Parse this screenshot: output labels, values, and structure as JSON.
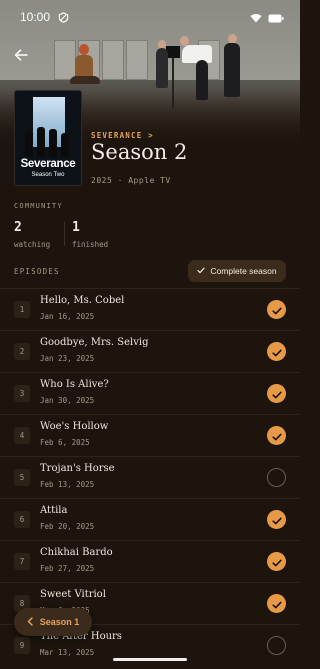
{
  "status_bar": {
    "time": "10:00"
  },
  "show": {
    "name": "SEVERANCE",
    "link_suffix": " >"
  },
  "poster": {
    "title": "Severance",
    "subtitle": "Season Two"
  },
  "season": {
    "title": "Season 2",
    "meta": "2025 · Apple TV"
  },
  "community": {
    "label": "COMMUNITY",
    "watching": {
      "count": "2",
      "label": "watching"
    },
    "finished": {
      "count": "1",
      "label": "finished"
    }
  },
  "episodes_section": {
    "label": "EPISODES",
    "complete_button": "Complete season"
  },
  "episodes": [
    {
      "number": "1",
      "title": "Hello, Ms. Cobel",
      "date": "Jan 16, 2025",
      "watched": true
    },
    {
      "number": "2",
      "title": "Goodbye, Mrs. Selvig",
      "date": "Jan 23, 2025",
      "watched": true
    },
    {
      "number": "3",
      "title": "Who Is Alive?",
      "date": "Jan 30, 2025",
      "watched": true
    },
    {
      "number": "4",
      "title": "Woe's Hollow",
      "date": "Feb 6, 2025",
      "watched": true
    },
    {
      "number": "5",
      "title": "Trojan's Horse",
      "date": "Feb 13, 2025",
      "watched": false
    },
    {
      "number": "6",
      "title": "Attila",
      "date": "Feb 20, 2025",
      "watched": true
    },
    {
      "number": "7",
      "title": "Chikhai Bardo",
      "date": "Feb 27, 2025",
      "watched": true
    },
    {
      "number": "8",
      "title": "Sweet Vitriol",
      "date": "Mar 6, 2025",
      "watched": true
    },
    {
      "number": "9",
      "title": "The After Hours",
      "date": "Mar 13, 2025",
      "watched": false
    }
  ],
  "season_nav": {
    "label": "Season 1"
  },
  "colors": {
    "accent": "#e69a48",
    "background": "#1c140d",
    "muted": "#a89884"
  }
}
